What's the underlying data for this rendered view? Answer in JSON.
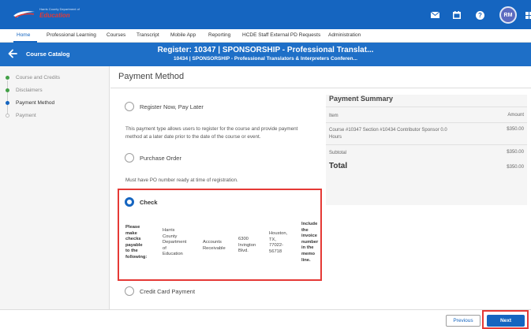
{
  "header": {
    "logo_tagline": "Harris County Department of",
    "logo_brand": "Education",
    "user_initials": "RM",
    "icons": [
      "mail-icon",
      "calendar-icon",
      "help-icon",
      "apps-grid-icon"
    ]
  },
  "nav": {
    "items": [
      "Home",
      "Professional Learning",
      "Courses",
      "Transcript",
      "Mobile App",
      "Reporting",
      "HCDE Staff External PD Requests",
      "Administration"
    ],
    "active": "Home"
  },
  "course": {
    "back_label": "Course Catalog",
    "title": "Register: 10347 | SPONSORSHIP - Professional Translat...",
    "subtitle": "10434 | SPONSORSHIP - Professional Translators & Interpreters Conferen..."
  },
  "steps": [
    {
      "label": "Course and Credits",
      "state": "done"
    },
    {
      "label": "Disclaimers",
      "state": "done"
    },
    {
      "label": "Payment Method",
      "state": "current"
    },
    {
      "label": "Payment",
      "state": "todo"
    }
  ],
  "page_title": "Payment Method",
  "options": {
    "register_later": {
      "label": "Register Now, Pay Later",
      "desc": "This payment type allows users to register for the course and provide payment method at a later date prior to the date of the course or event."
    },
    "purchase_order": {
      "label": "Purchase Order",
      "desc": "Must have PO number ready at time of registration."
    },
    "check": {
      "label": "Check",
      "col1": [
        "Please",
        "make",
        "checks",
        "payable",
        "to the",
        "following:"
      ],
      "col2": [
        "Harris",
        "County",
        "Department",
        "of",
        "Education"
      ],
      "col3": [
        "Accounts",
        "Receivable"
      ],
      "col4": [
        "6300",
        "Irvington",
        "Blvd."
      ],
      "col5": [
        "Houston,",
        "TX,",
        "77022-",
        "56718"
      ],
      "col6": [
        "Include",
        "the",
        "invoice",
        "number",
        "in the",
        "memo",
        "line."
      ]
    },
    "credit_card": {
      "label": "Credit Card Payment"
    }
  },
  "summary": {
    "title": "Payment Summary",
    "col_item": "Item",
    "col_amount": "Amount",
    "item_desc_1": "Course #10347 Section #10434 Contributor Sponsor 0.0",
    "item_desc_2": "Hours",
    "item_amount": "$350.00",
    "subtotal_label": "Subtotal",
    "subtotal": "$350.00",
    "total_label": "Total",
    "total": "$350.00"
  },
  "footer": {
    "previous": "Previous",
    "next": "Next"
  }
}
